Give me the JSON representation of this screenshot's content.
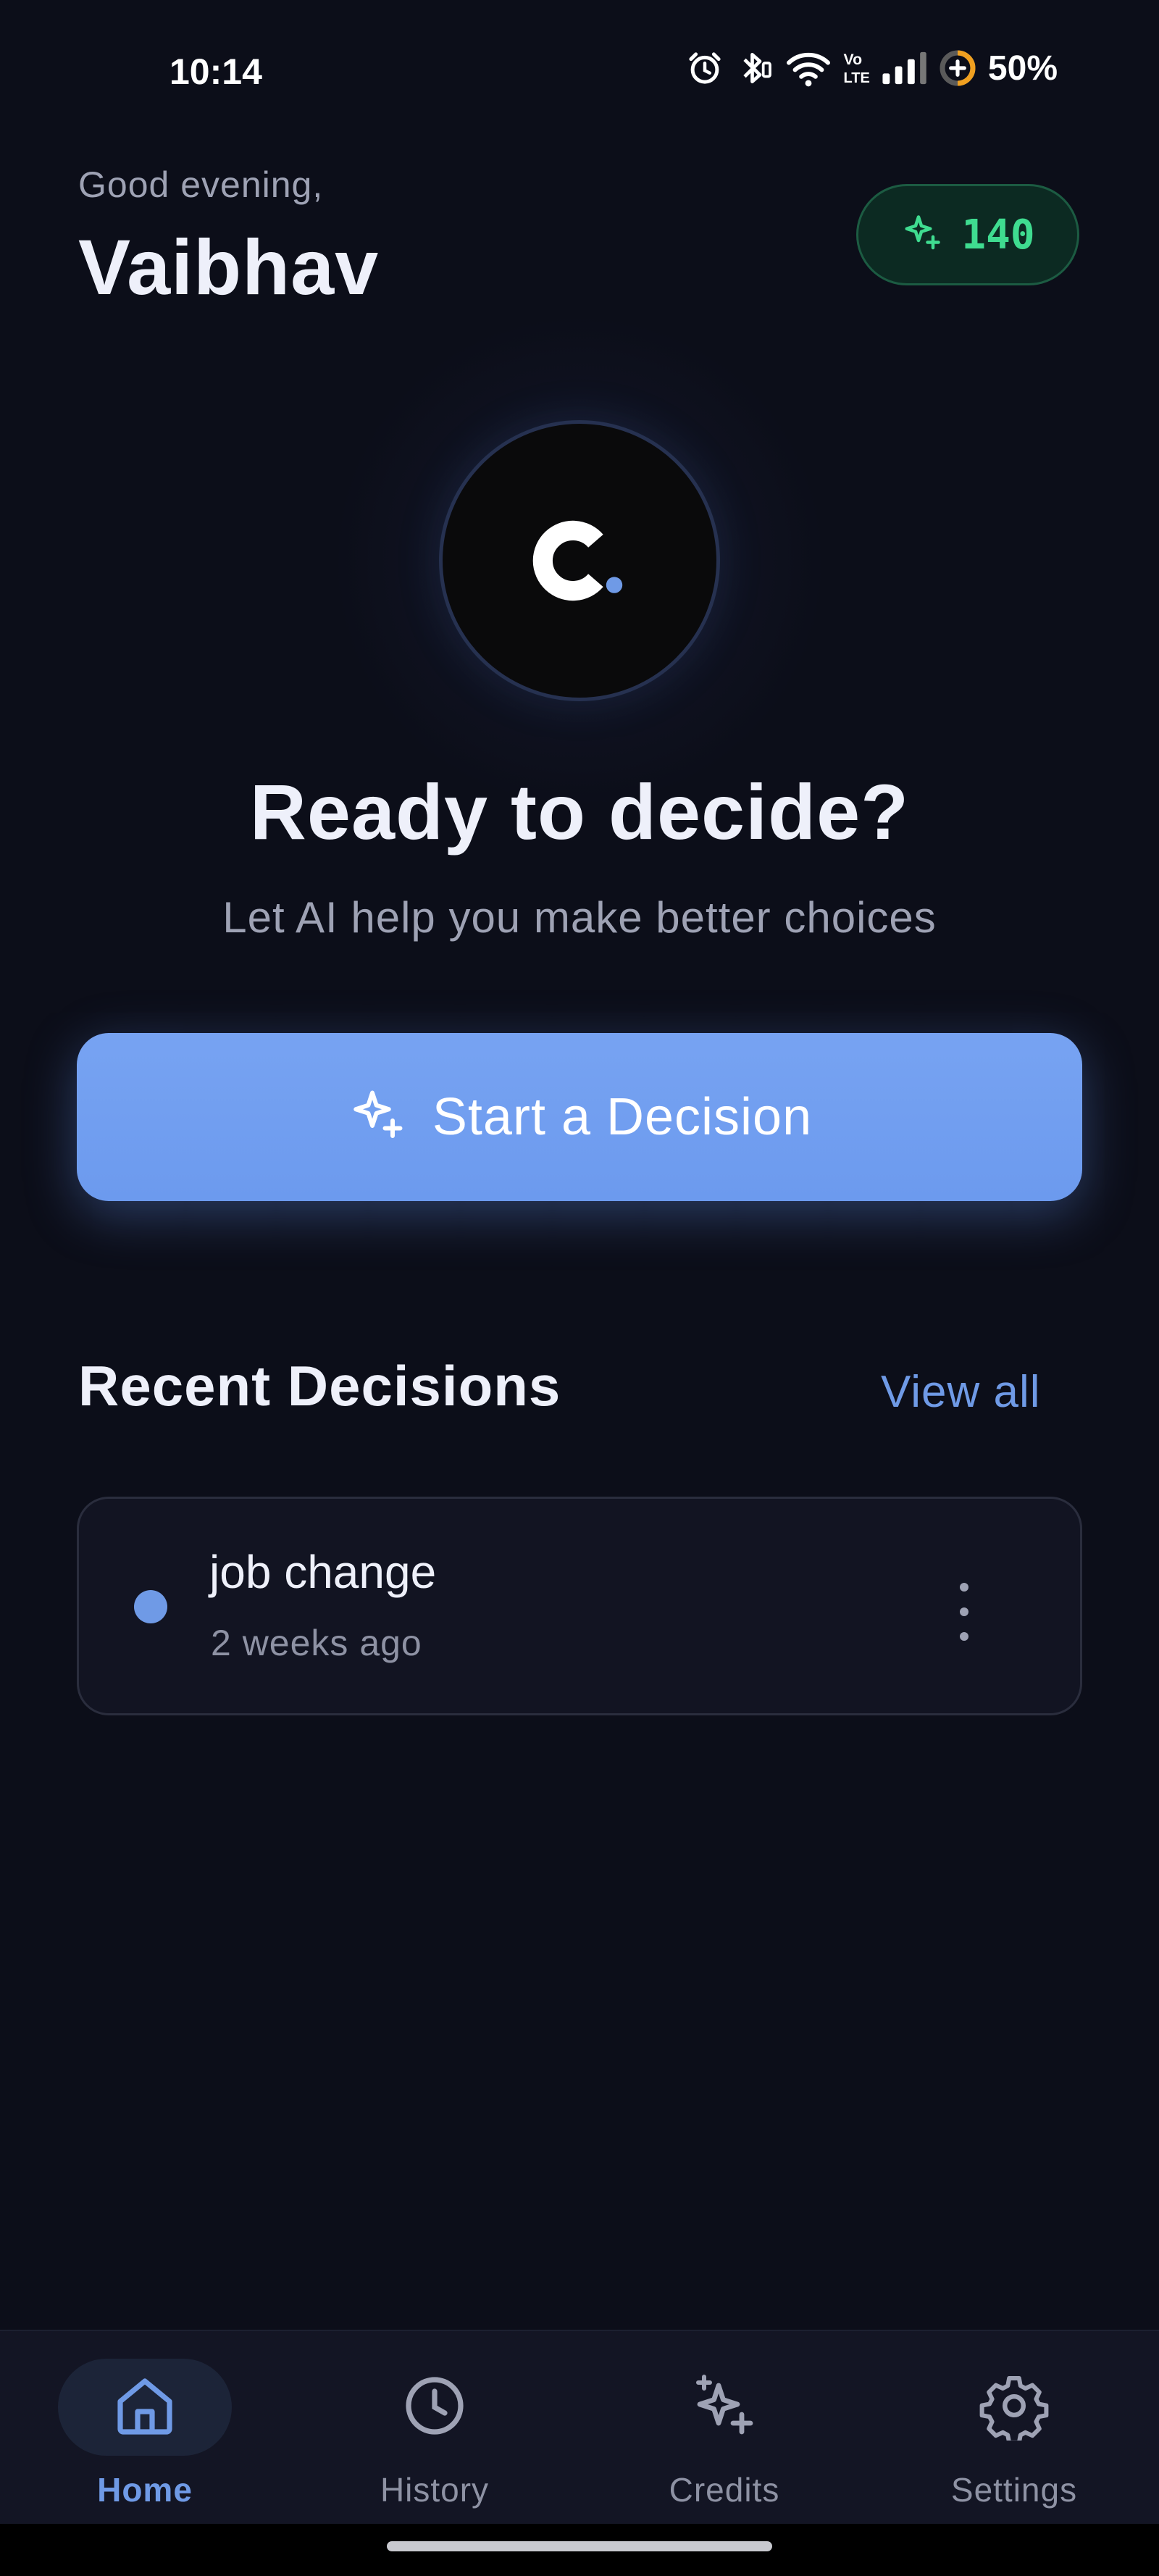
{
  "status_bar": {
    "time": "10:14",
    "battery": "50%",
    "icons": [
      "alarm-icon",
      "bluetooth-icon",
      "wifi-icon",
      "volte-icon",
      "signal-icon",
      "battery-saver-icon"
    ]
  },
  "header": {
    "greeting": "Good evening,",
    "user_name": "Vaibhav",
    "credits": "140",
    "credits_icon": "sparkle-icon"
  },
  "logo": {
    "letter": "C",
    "accent_color": "#6f9ae6"
  },
  "hero": {
    "title": "Ready to decide?",
    "subtitle": "Let AI help you make better choices"
  },
  "primary_action": {
    "label": "Start a Decision",
    "icon": "sparkle-icon"
  },
  "recent": {
    "title": "Recent Decisions",
    "view_all": "View all",
    "items": [
      {
        "title": "job change",
        "time": "2 weeks ago"
      }
    ]
  },
  "nav": {
    "items": [
      {
        "label": "Home",
        "icon": "home-icon",
        "active": true
      },
      {
        "label": "History",
        "icon": "clock-icon",
        "active": false
      },
      {
        "label": "Credits",
        "icon": "sparkle-icon",
        "active": false
      },
      {
        "label": "Settings",
        "icon": "gear-icon",
        "active": false
      }
    ]
  },
  "colors": {
    "background": "#0c0e19",
    "accent": "#6f9ae6",
    "credits_green": "#3fdc90"
  }
}
